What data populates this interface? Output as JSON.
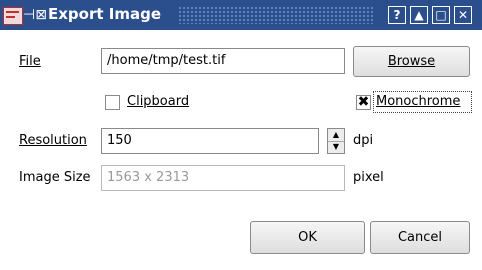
{
  "window": {
    "title": "Export Image",
    "controls": {
      "help": "?",
      "shade": "▲",
      "maximize": "□",
      "close": "✕"
    }
  },
  "file": {
    "label": "File",
    "value": "/home/tmp/test.tif",
    "browse_label": "Browse"
  },
  "options": {
    "clipboard_label": "Clipboard",
    "clipboard_checked": false,
    "monochrome_label": "Monochrome",
    "monochrome_checked": true
  },
  "resolution": {
    "label": "Resolution",
    "value": "150",
    "unit": "dpi"
  },
  "image_size": {
    "label": "Image Size",
    "value": "1563 x 2313",
    "unit": "pixel"
  },
  "buttons": {
    "ok": "OK",
    "cancel": "Cancel"
  },
  "icons": {
    "app": "image-export-icon",
    "pin": "pin-icon",
    "spin_up": "▲",
    "spin_down": "▼",
    "check": "✖"
  }
}
